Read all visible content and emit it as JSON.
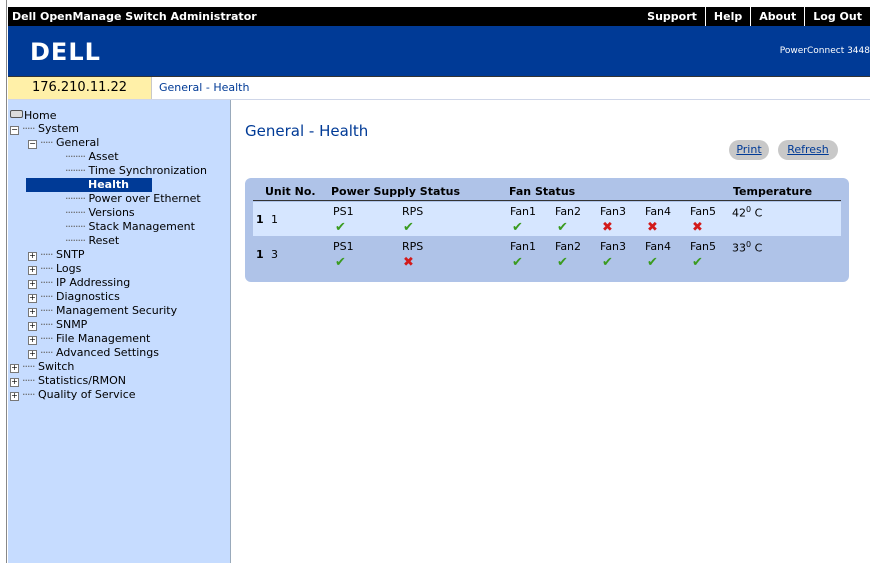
{
  "window": {
    "title": "Dell OpenManage Switch Administrator",
    "links": [
      "Support",
      "Help",
      "About",
      "Log Out"
    ]
  },
  "banner": {
    "logo": "DELL",
    "product": "PowerConnect 3448"
  },
  "address": {
    "ip": "176.210.11.22",
    "breadcrumb": "General - Health"
  },
  "sidebar": {
    "items": [
      {
        "label": "Home"
      },
      {
        "label": "System"
      },
      {
        "label": "General"
      },
      {
        "label": "Asset"
      },
      {
        "label": "Time Synchronization"
      },
      {
        "label": "Health"
      },
      {
        "label": "Power over Ethernet"
      },
      {
        "label": "Versions"
      },
      {
        "label": "Stack Management"
      },
      {
        "label": "Reset"
      },
      {
        "label": "SNTP"
      },
      {
        "label": "Logs"
      },
      {
        "label": "IP Addressing"
      },
      {
        "label": "Diagnostics"
      },
      {
        "label": "Management Security"
      },
      {
        "label": "SNMP"
      },
      {
        "label": "File Management"
      },
      {
        "label": "Advanced Settings"
      },
      {
        "label": "Switch"
      },
      {
        "label": "Statistics/RMON"
      },
      {
        "label": "Quality of Service"
      }
    ]
  },
  "main": {
    "title": "General - Health",
    "print_label": "Print",
    "refresh_label": "Refresh",
    "headers": {
      "unit": "Unit No.",
      "power": "Power Supply Status",
      "fan": "Fan Status",
      "temp": "Temperature"
    },
    "rows": [
      {
        "marker": "1",
        "unit": "1",
        "ps": [
          {
            "label": "PS1",
            "status": "ok"
          },
          {
            "label": "RPS",
            "status": "ok"
          }
        ],
        "fans": [
          {
            "label": "Fan1",
            "status": "ok"
          },
          {
            "label": "Fan2",
            "status": "ok"
          },
          {
            "label": "Fan3",
            "status": "fail"
          },
          {
            "label": "Fan4",
            "status": "fail"
          },
          {
            "label": "Fan5",
            "status": "fail"
          }
        ],
        "temp_value": "42",
        "temp_deg": "0",
        "temp_unit": "C"
      },
      {
        "marker": "1",
        "unit": "3",
        "ps": [
          {
            "label": "PS1",
            "status": "ok"
          },
          {
            "label": "RPS",
            "status": "fail"
          }
        ],
        "fans": [
          {
            "label": "Fan1",
            "status": "ok"
          },
          {
            "label": "Fan2",
            "status": "ok"
          },
          {
            "label": "Fan3",
            "status": "ok"
          },
          {
            "label": "Fan4",
            "status": "ok"
          },
          {
            "label": "Fan5",
            "status": "ok"
          }
        ],
        "temp_value": "33",
        "temp_deg": "0",
        "temp_unit": "C"
      }
    ]
  },
  "colors": {
    "banner": "#003a96",
    "sidebar": "#c6dcff",
    "ok": "#3a9b1f",
    "fail": "#d21a1a"
  }
}
